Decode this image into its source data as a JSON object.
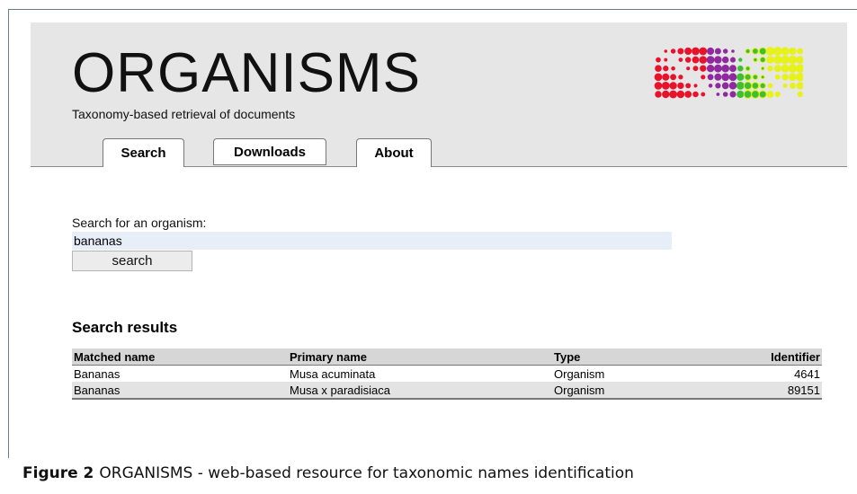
{
  "header": {
    "title": "ORGANISMS",
    "subtitle": "Taxonomy-based retrieval of documents"
  },
  "tabs": [
    {
      "label": "Search",
      "active": true
    },
    {
      "label": "Downloads",
      "active": false
    },
    {
      "label": "About",
      "active": false
    }
  ],
  "search": {
    "label": "Search for an organism:",
    "value": "bananas",
    "button_label": "search"
  },
  "results": {
    "heading": "Search results",
    "columns": [
      "Matched name",
      "Primary name",
      "Type",
      "Identifier"
    ],
    "rows": [
      [
        "Bananas",
        "Musa acuminata",
        "Organism",
        "4641"
      ],
      [
        "Bananas",
        "Musa x paradisiaca",
        "Organism",
        "89151"
      ]
    ]
  },
  "caption": {
    "label": "Figure 2",
    "text": "ORGANISMS - web-based resource for taxonomic names identification"
  },
  "colors": {
    "logo_red": "#e8132a",
    "logo_purple": "#8e2a9e",
    "logo_yellow": "#e6f21a",
    "logo_green": "#3fbf2f",
    "header_bg": "#e6e6e6"
  }
}
